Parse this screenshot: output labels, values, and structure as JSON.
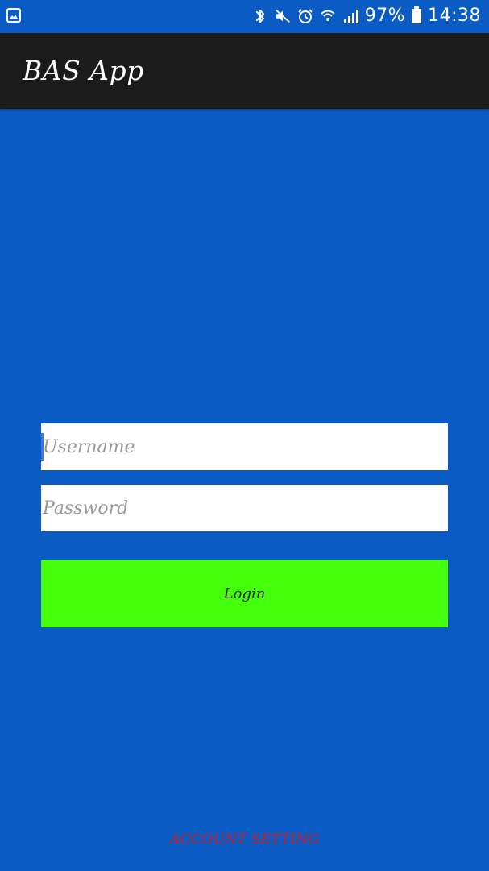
{
  "status_bar": {
    "battery_percent": "97%",
    "time": "14:38",
    "icons": [
      "image-icon",
      "bluetooth-icon",
      "mute-icon",
      "alarm-icon",
      "wifi-icon",
      "signal-icon",
      "battery-icon"
    ]
  },
  "app_bar": {
    "title": "BAS App"
  },
  "form": {
    "username_placeholder": "Username",
    "password_placeholder": "Password",
    "login_label": "Login"
  },
  "footer": {
    "account_setting_label": "ACCOUNT SETTING"
  },
  "colors": {
    "background": "#0a5bc4",
    "app_bar": "#1b1b1b",
    "login_button": "#44ff0a",
    "account_setting_text": "#d11a1a"
  }
}
